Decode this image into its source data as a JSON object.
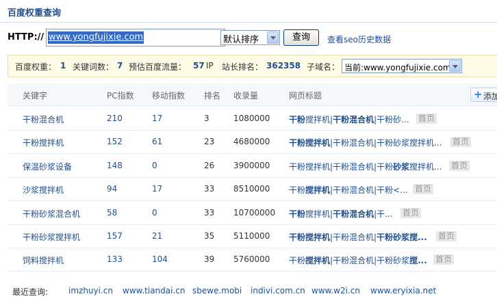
{
  "page_title": "百度权重查询",
  "search": {
    "protocol_label": "HTTP://",
    "url_value": "www.yongfujixie.com",
    "sort_selected": "默认排序",
    "query_button": "查询",
    "seo_history_link": "查看seo历史数据"
  },
  "stats": {
    "weight_label": "百度权重：",
    "weight_value": "1",
    "keywords_label": "关键词数：",
    "keywords_value": "7",
    "traffic_label": "预估百度流量：",
    "traffic_value": "57",
    "traffic_unit": "IP",
    "alexa_label": "站长排名：",
    "alexa_value": "362358",
    "subdomain_label": "子域名：",
    "subdomain_selected": "当前:www.yongfujixie.com"
  },
  "table": {
    "headers": [
      "关键字",
      "PC指数",
      "移动指数",
      "排名",
      "收录量",
      "网页标题"
    ],
    "add_button": "添加",
    "home_badge": "首页",
    "rows": [
      {
        "keyword": "干粉混合机",
        "pc": "210",
        "mobile": "17",
        "rank": "3",
        "count": "1080000",
        "title": [
          {
            "t": "干粉",
            "b": true
          },
          {
            "t": "搅拌机|",
            "b": false
          },
          {
            "t": "干粉混合机",
            "b": true
          },
          {
            "t": "|干粉砂...",
            "b": false
          }
        ]
      },
      {
        "keyword": "干粉搅拌机",
        "pc": "152",
        "mobile": "61",
        "rank": "23",
        "count": "4680000",
        "title": [
          {
            "t": "干粉搅拌机",
            "b": true
          },
          {
            "t": "|干粉混合机|干粉砂浆搅拌机...",
            "b": false
          }
        ]
      },
      {
        "keyword": "保温砂浆设备",
        "pc": "148",
        "mobile": "0",
        "rank": "26",
        "count": "3900000",
        "title": [
          {
            "t": "干粉搅拌机|干粉混合机|干粉",
            "b": false
          },
          {
            "t": "砂浆",
            "b": true
          },
          {
            "t": "搅拌机...",
            "b": false
          }
        ]
      },
      {
        "keyword": "沙浆搅拌机",
        "pc": "94",
        "mobile": "17",
        "rank": "33",
        "count": "8510000",
        "title": [
          {
            "t": "干粉",
            "b": false
          },
          {
            "t": "搅拌机",
            "b": true
          },
          {
            "t": "|干粉混合机|干粉<...",
            "b": false
          }
        ]
      },
      {
        "keyword": "干粉砂浆混合机",
        "pc": "58",
        "mobile": "0",
        "rank": "33",
        "count": "10700000",
        "title": [
          {
            "t": "干粉",
            "b": true
          },
          {
            "t": "搅拌机|",
            "b": false
          },
          {
            "t": "干粉混合机",
            "b": true
          },
          {
            "t": "|干...",
            "b": false
          }
        ]
      },
      {
        "keyword": "干粉砂浆搅拌机",
        "pc": "157",
        "mobile": "21",
        "rank": "35",
        "count": "5110000",
        "title": [
          {
            "t": "干粉搅拌机",
            "b": true
          },
          {
            "t": "|干粉混合机|",
            "b": false
          },
          {
            "t": "干粉砂浆搅...",
            "b": true
          }
        ]
      },
      {
        "keyword": "饲料搅拌机",
        "pc": "133",
        "mobile": "104",
        "rank": "39",
        "count": "5760000",
        "title": [
          {
            "t": "干粉",
            "b": false
          },
          {
            "t": "搅拌机",
            "b": true
          },
          {
            "t": "|干粉混合机|干粉砂浆",
            "b": false
          },
          {
            "t": "搅...",
            "b": true
          }
        ]
      }
    ]
  },
  "recent": {
    "label": "最近查询:",
    "links": [
      "imzhuyi.cn",
      "www.tiandai.cn",
      "sbewe.mobi",
      "indivi.com.cn",
      "www.w2i.cn",
      "www.eryixia.net"
    ]
  },
  "colors": {
    "link_blue": "#1f4f8e",
    "stats_bg": "#fefbe6",
    "header_bg": "#f4f7fb"
  }
}
